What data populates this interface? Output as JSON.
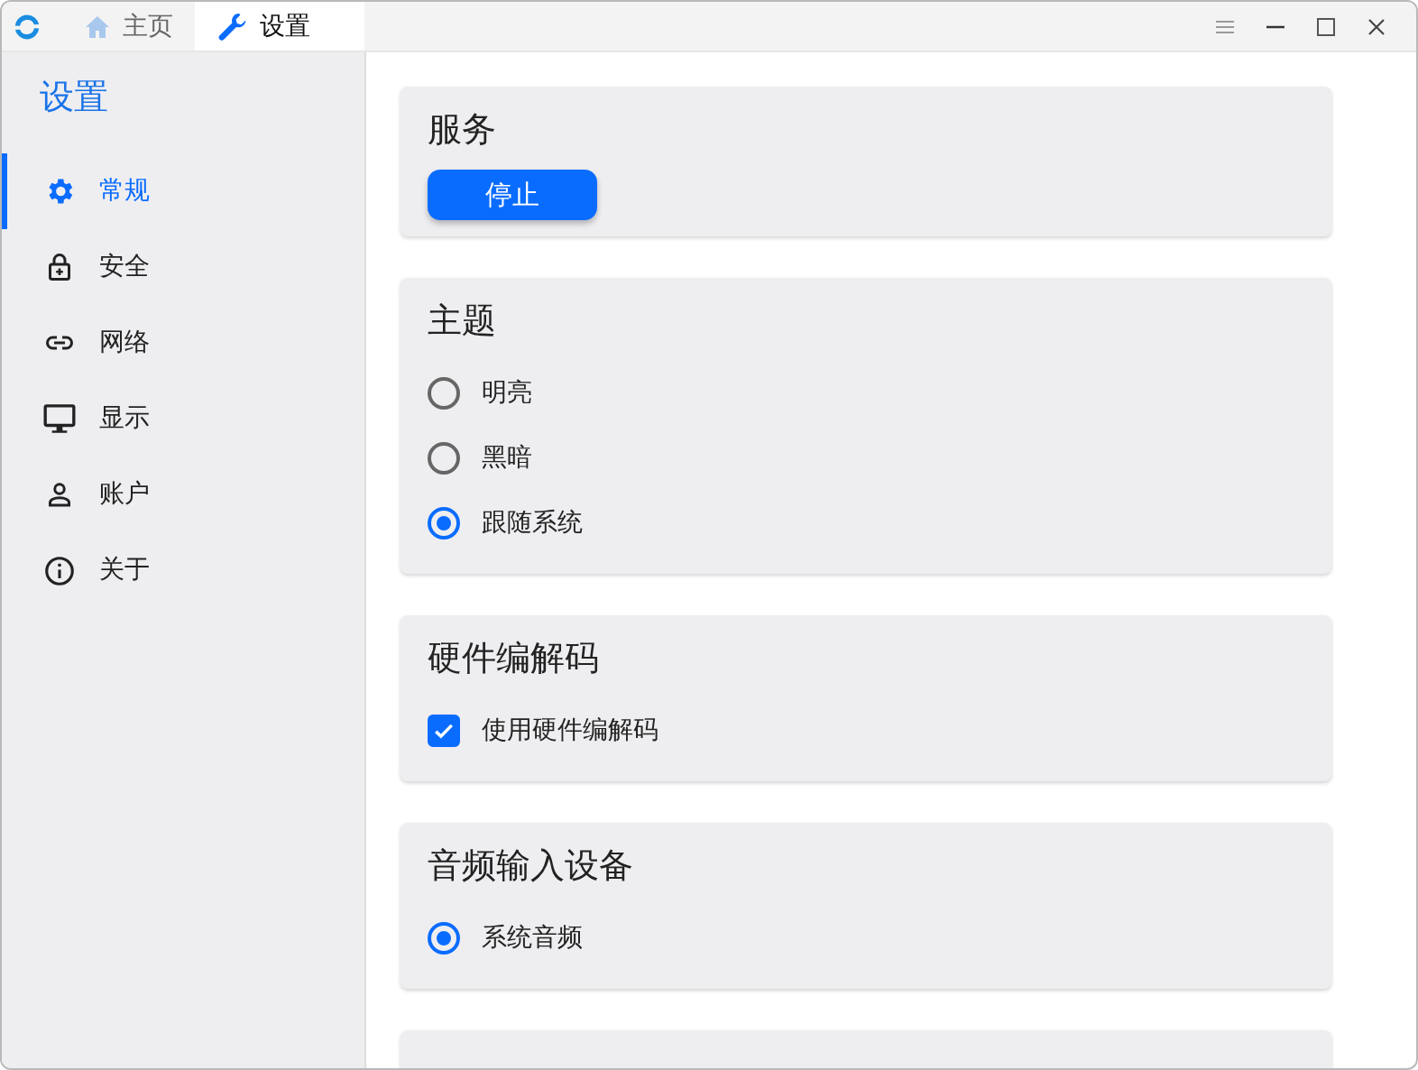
{
  "tabs": [
    {
      "label": "主页",
      "selected": false
    },
    {
      "label": "设置",
      "selected": true
    }
  ],
  "sidebar": {
    "title": "设置",
    "items": [
      {
        "label": "常规",
        "selected": true
      },
      {
        "label": "安全",
        "selected": false
      },
      {
        "label": "网络",
        "selected": false
      },
      {
        "label": "显示",
        "selected": false
      },
      {
        "label": "账户",
        "selected": false
      },
      {
        "label": "关于",
        "selected": false
      }
    ]
  },
  "sections": [
    {
      "title": "服务",
      "items": [
        {
          "kind": "button",
          "label": "停止"
        }
      ]
    },
    {
      "title": "主题",
      "items": [
        {
          "kind": "radio",
          "label": "明亮",
          "selected": false
        },
        {
          "kind": "radio",
          "label": "黑暗",
          "selected": false
        },
        {
          "kind": "radio",
          "label": "跟随系统",
          "selected": true
        }
      ]
    },
    {
      "title": "硬件编解码",
      "items": [
        {
          "kind": "checkbox",
          "label": "使用硬件编解码",
          "checked": true
        }
      ]
    },
    {
      "title": "音频输入设备",
      "items": [
        {
          "kind": "radio",
          "label": "系统音频",
          "selected": true
        }
      ]
    }
  ]
}
